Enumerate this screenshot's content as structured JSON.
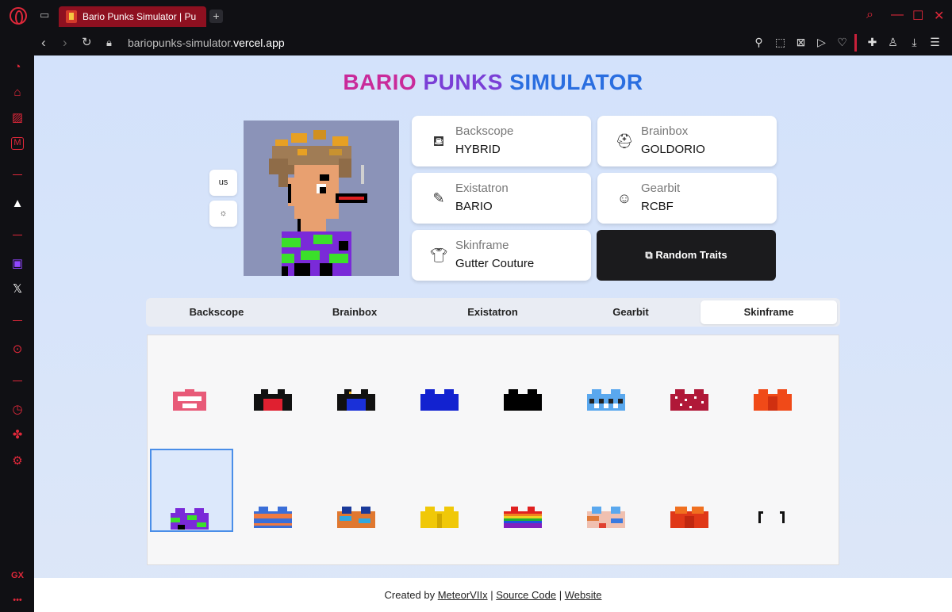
{
  "browser": {
    "tab_title": "Bario Punks Simulator | Pu",
    "url_prefix": "bariopunks-simulator.",
    "url_host": "vercel.app"
  },
  "sidebar_bottom": {
    "gx_label": "GX",
    "more_label": "•••"
  },
  "page": {
    "title_part1": "BARIO",
    "title_part2": "PUNKS",
    "title_part3": "SIMULATOR",
    "lang_button": "us",
    "traits": [
      {
        "label": "Backscope",
        "value": "HYBRID",
        "icon": "paint-bucket-icon"
      },
      {
        "label": "Brainbox",
        "value": "GOLDORIO",
        "icon": "helmet-icon"
      },
      {
        "label": "Existatron",
        "value": "BARIO",
        "icon": "pipette-icon"
      },
      {
        "label": "Gearbit",
        "value": "RCBF",
        "icon": "scan-face-icon"
      },
      {
        "label": "Skinframe",
        "value": "Gutter Couture",
        "icon": "shirt-icon"
      }
    ],
    "random_button": "Random Traits",
    "tabs": [
      "Backscope",
      "Brainbox",
      "Existatron",
      "Gearbit",
      "Skinframe"
    ],
    "active_tab": "Skinframe",
    "footer_created_by": "Created by",
    "footer_author": "MeteorVIIx",
    "footer_sep1": "|",
    "footer_source": "Source Code",
    "footer_sep2": "|",
    "footer_website": "Website"
  },
  "colors": {
    "accent_red": "#e0283a",
    "title_pink": "#c92a9a",
    "title_purple": "#7a3fd6",
    "title_blue": "#2a6ee0"
  }
}
